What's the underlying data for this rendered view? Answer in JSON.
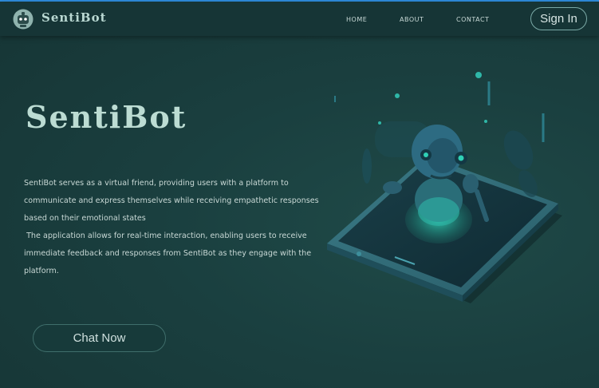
{
  "navbar": {
    "brand": "SentiBot",
    "logo_icon": "robot-face-icon",
    "links": [
      {
        "label": "HOME"
      },
      {
        "label": "ABOUT"
      },
      {
        "label": "CONTACT"
      }
    ],
    "signin_label": "Sign In"
  },
  "hero": {
    "title": "SentiBot",
    "paragraphs": [
      "SentiBot serves as a virtual friend, providing users with a platform to communicate and express themselves while receiving empathetic responses based on their emotional states",
      " The application allows for real-time interaction, enabling users to receive immediate feedback and responses from SentiBot as they engage with the platform."
    ],
    "cta_label": "Chat Now",
    "illustration_icon": "robot-on-phone-illustration"
  },
  "colors": {
    "background": "#1a3f3f",
    "navbar": "#163536",
    "accent_teal": "#2fb7a8",
    "top_line": "#2f8fe0"
  }
}
